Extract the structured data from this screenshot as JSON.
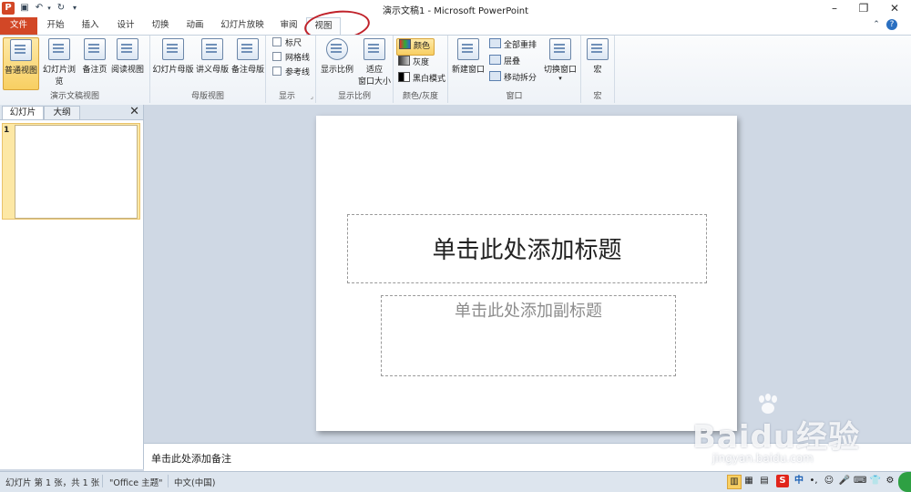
{
  "window": {
    "title": "演示文稿1 - Microsoft PowerPoint",
    "app_icon_letter": "P"
  },
  "tabs": {
    "file": "文件",
    "items": [
      "开始",
      "插入",
      "设计",
      "切换",
      "动画",
      "幻灯片放映",
      "审阅",
      "视图"
    ],
    "active": "视图"
  },
  "ribbon": {
    "presentation_views": {
      "label": "演示文稿视图",
      "buttons": [
        "普通视图",
        "幻灯片浏览",
        "备注页",
        "阅读视图"
      ]
    },
    "master_views": {
      "label": "母版视图",
      "buttons": [
        "幻灯片母版",
        "讲义母版",
        "备注母版"
      ]
    },
    "show": {
      "label": "显示",
      "checkboxes": [
        "标尺",
        "网格线",
        "参考线"
      ]
    },
    "zoom": {
      "label": "显示比例",
      "zoom_button": "显示比例",
      "fit_button_line1": "适应",
      "fit_button_line2": "窗口大小"
    },
    "color": {
      "label": "颜色/灰度",
      "options": [
        "颜色",
        "灰度",
        "黑白模式"
      ]
    },
    "window": {
      "label": "窗口",
      "new_window": "新建窗口",
      "arrange_all": "全部重排",
      "cascade": "层叠",
      "move_split": "移动拆分",
      "switch_windows": "切换窗口"
    },
    "macros": {
      "label": "宏",
      "button": "宏"
    }
  },
  "pane": {
    "tab_slides": "幻灯片",
    "tab_outline": "大纲",
    "close": "✕",
    "slide_number": "1"
  },
  "slide": {
    "title_placeholder": "单击此处添加标题",
    "subtitle_placeholder": "单击此处添加副标题"
  },
  "notes": {
    "placeholder": "单击此处添加备注"
  },
  "status": {
    "slide_info": "幻灯片 第 1 张，共 1 张",
    "theme": "\"Office 主题\"",
    "language": "中文(中国)",
    "ime": "中"
  },
  "watermark": {
    "main": "Baidu经验",
    "sub": "jingyan.baidu.com"
  },
  "colors": {
    "file_tab": "#d24726",
    "highlight": "#f8cf62",
    "annotation_circle": "#c0222a"
  }
}
